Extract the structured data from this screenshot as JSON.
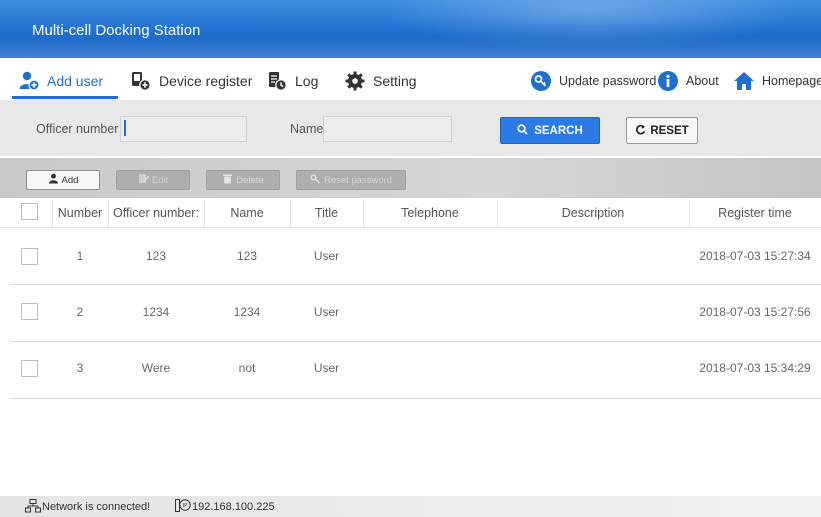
{
  "app": {
    "title": "Multi-cell Docking Station"
  },
  "nav": {
    "tabs": [
      {
        "label": "Add user",
        "icon": "add-user-icon",
        "active": true
      },
      {
        "label": "Device register",
        "icon": "device-register-icon",
        "active": false
      },
      {
        "label": "Log",
        "icon": "log-icon",
        "active": false
      },
      {
        "label": "Setting",
        "icon": "gear-icon",
        "active": false
      }
    ],
    "right": [
      {
        "label": "Update password",
        "icon": "key-icon"
      },
      {
        "label": "About",
        "icon": "info-icon"
      },
      {
        "label": "Homepage",
        "icon": "home-icon"
      }
    ]
  },
  "search": {
    "officer_label": "Officer number",
    "officer_value": "",
    "name_label": "Name:",
    "name_value": "",
    "search_button": "SEARCH",
    "reset_button": "RESET"
  },
  "toolbar": {
    "add": "Add",
    "edit": "Edit",
    "delete": "Delete",
    "reset_password": "Reset password"
  },
  "table": {
    "headers": [
      "Number",
      "Officer number:",
      "Name",
      "Title",
      "Telephone",
      "Description",
      "Register time"
    ],
    "rows": [
      {
        "number": "1",
        "officer": "123",
        "name": "123",
        "title": "User",
        "telephone": "",
        "description": "",
        "register_time": "2018-07-03 15:27:34"
      },
      {
        "number": "2",
        "officer": "1234",
        "name": "1234",
        "title": "User",
        "telephone": "",
        "description": "",
        "register_time": "2018-07-03 15:27:56"
      },
      {
        "number": "3",
        "officer": "Were",
        "name": "not",
        "title": "User",
        "telephone": "",
        "description": "",
        "register_time": "2018-07-03 15:34:29"
      }
    ]
  },
  "status": {
    "network": "Network is connected!",
    "ip": "192.168.100.225"
  },
  "colors": {
    "accent": "#1f6fd0",
    "search_button": "#2c7be5",
    "title_bar": "#1f6fd0"
  }
}
